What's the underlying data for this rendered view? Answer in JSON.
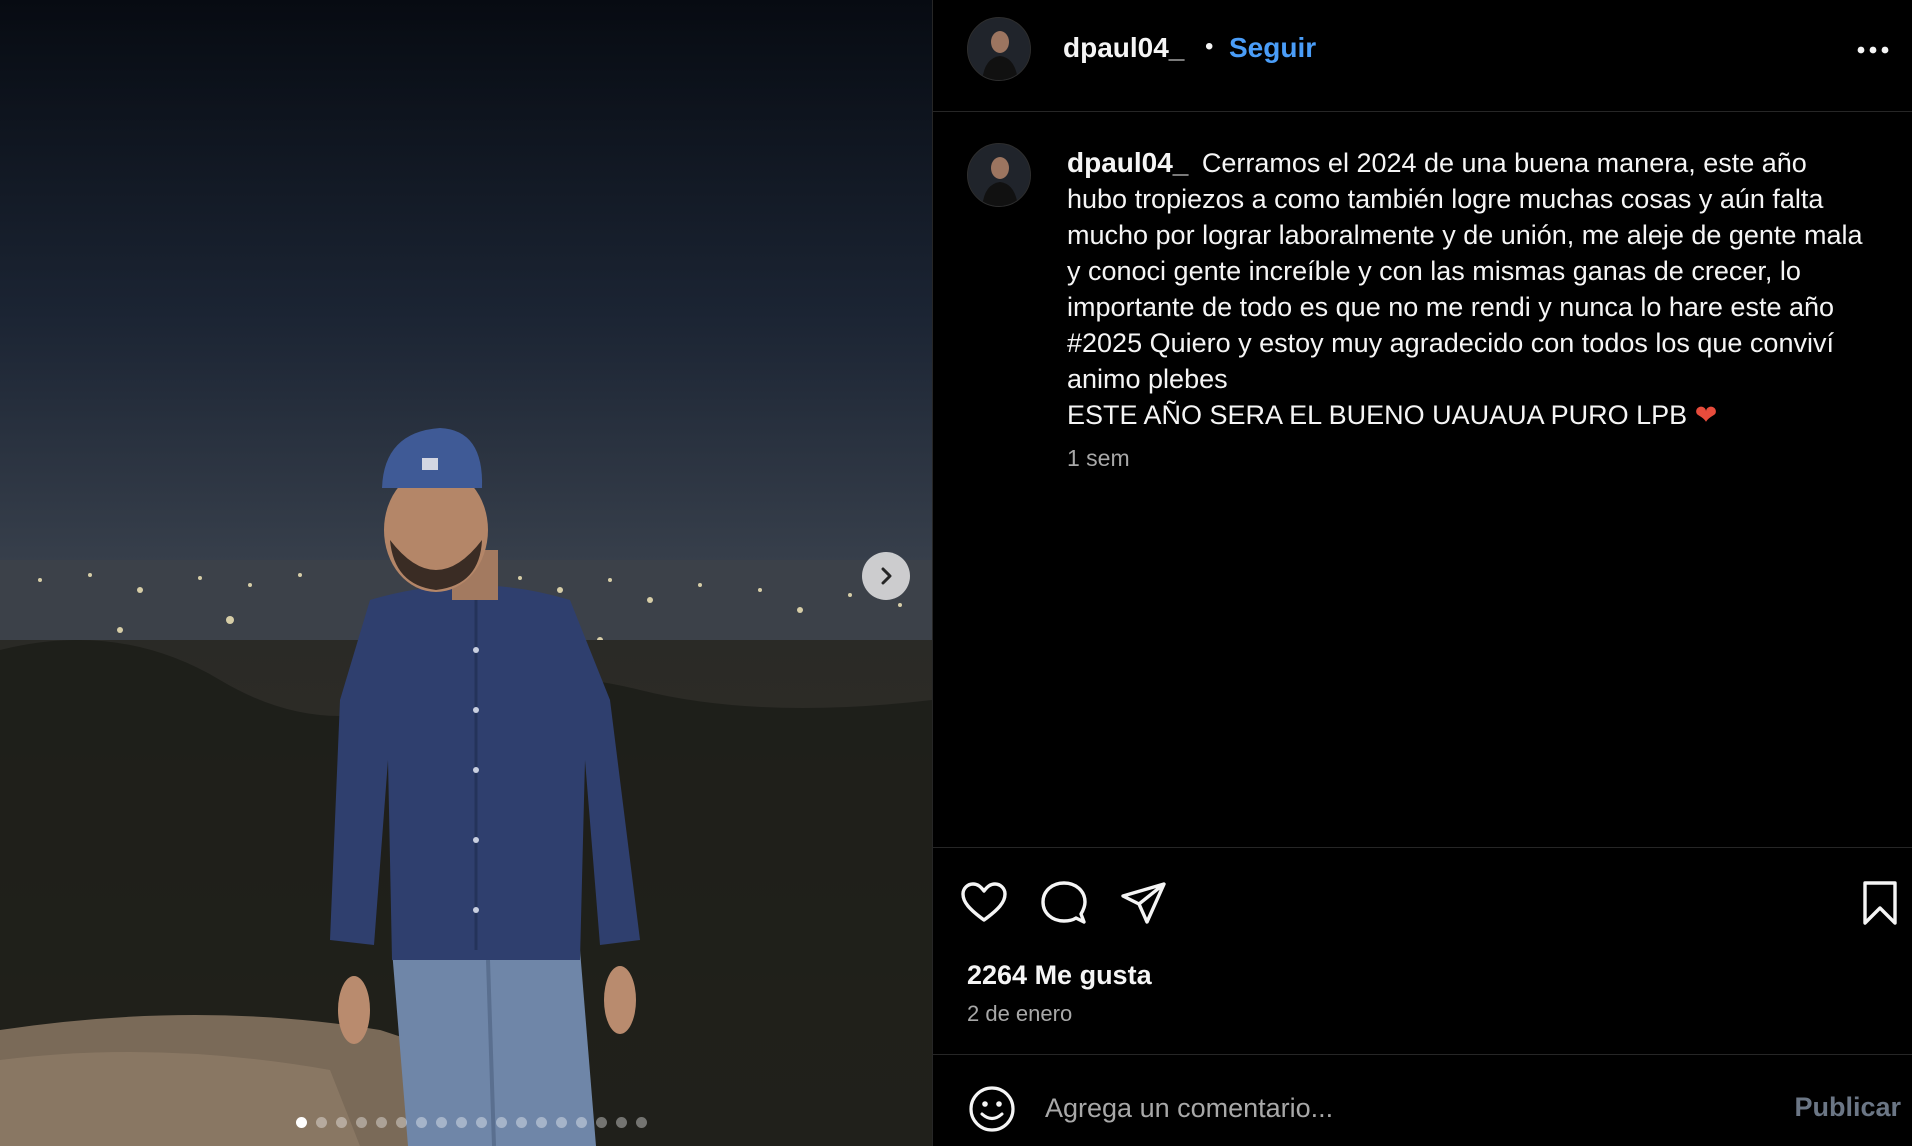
{
  "post": {
    "username": "dpaul04_",
    "follow_label": "Seguir",
    "bullet": "•",
    "caption_text": "Cerramos el 2024 de una buena manera, este año hubo tropiezos a como también logre muchas cosas y aún falta mucho por lograr laboralmente y de unión, me aleje de gente mala y conoci gente increíble y con las mismas ganas de crecer, lo importante de todo es que no me rendi y nunca lo hare este año #2025 Quiero y estoy muy agradecido con todos los que conviví animo plebes",
    "caption_tail": "ESTE AÑO SERA EL BUENO UAUAUA PURO LPB",
    "caption_emoji": "❤",
    "time_ago": "1 sem",
    "likes": "2264 Me gusta",
    "date": "2 de enero",
    "comment_placeholder": "Agrega un comentario...",
    "publish_label": "Publicar"
  },
  "carousel": {
    "total_images": 18,
    "active_index": 0
  },
  "icons": {
    "more": "more-options-icon",
    "like": "heart-icon",
    "comment": "comment-bubble-icon",
    "share": "paper-plane-icon",
    "save": "bookmark-icon",
    "emoji": "emoji-icon",
    "next": "chevron-right-icon"
  },
  "colors": {
    "follow_accent": "#4a9df8",
    "publish_disabled": "#6b7685",
    "muted_text": "#a8a8a8",
    "divider": "#262626"
  }
}
